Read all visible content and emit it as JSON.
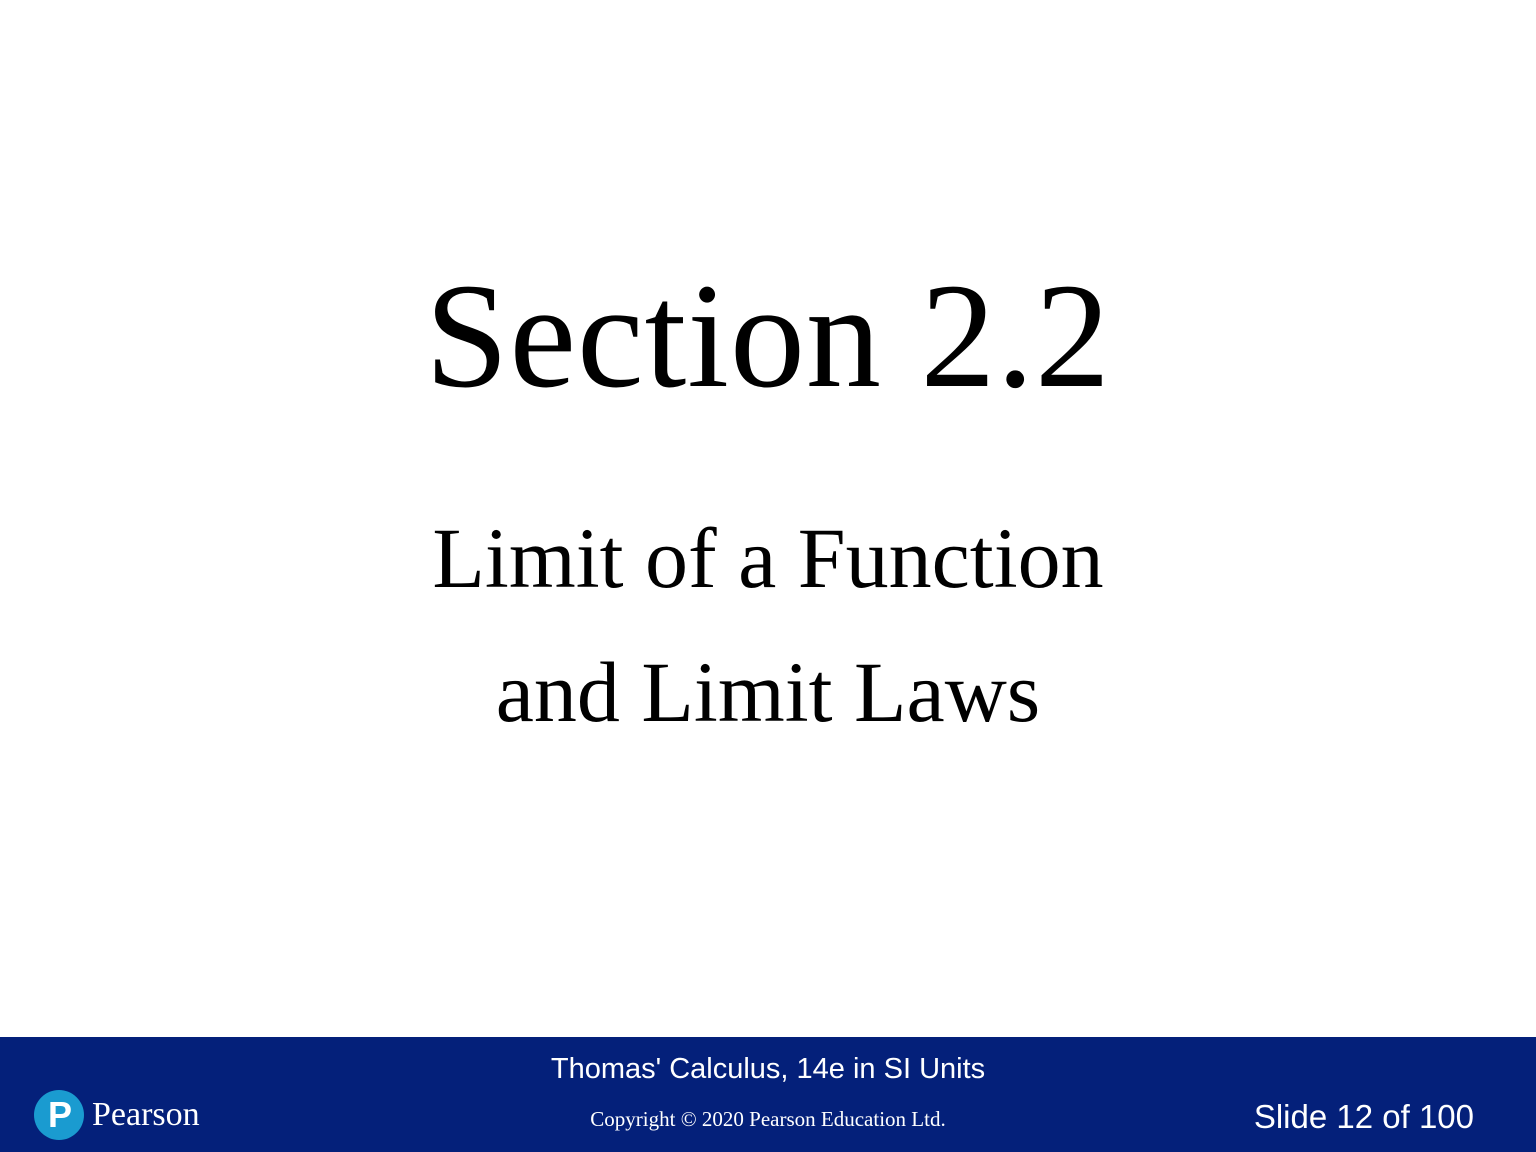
{
  "slide": {
    "title": "Section 2.2",
    "subtitle_lines": [
      "Limit of a Function",
      "and Limit Laws"
    ]
  },
  "footer": {
    "book_title": "Thomas' Calculus, 14e in SI Units",
    "copyright": "Copyright © 2020 Pearson Education Ltd.",
    "slide_number": "Slide 12 of 100",
    "logo": {
      "mark_letter": "P",
      "text": "Pearson",
      "mark_color": "#1a9bd0"
    },
    "background_color": "#04207a"
  }
}
